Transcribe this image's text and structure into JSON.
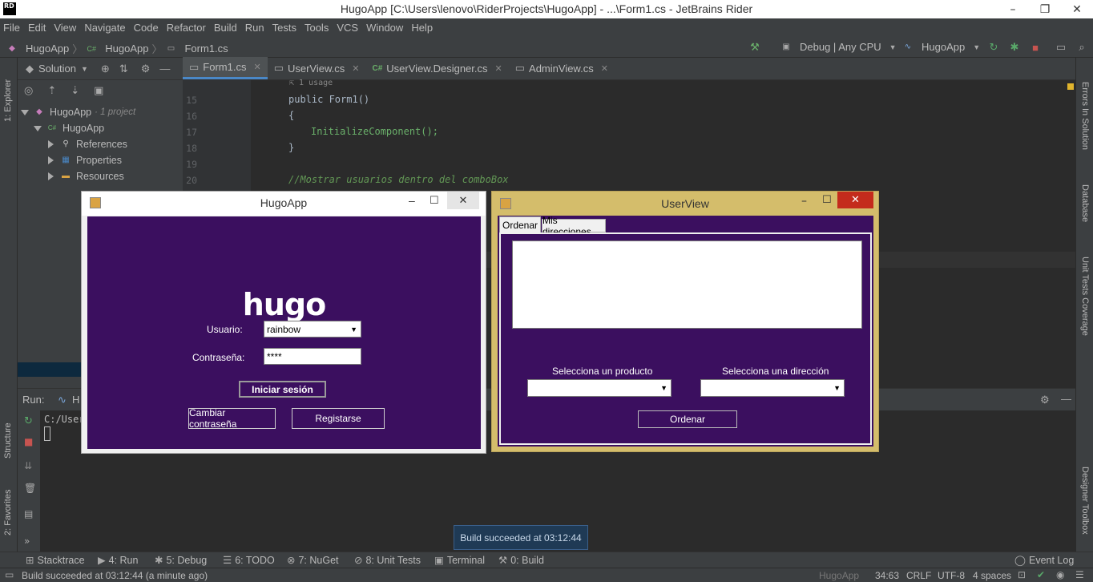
{
  "window": {
    "title": "HugoApp [C:\\Users\\lenovo\\RiderProjects\\HugoApp] - ...\\Form1.cs - JetBrains Rider",
    "logo": "RD"
  },
  "menu": [
    "File",
    "Edit",
    "View",
    "Navigate",
    "Code",
    "Refactor",
    "Build",
    "Run",
    "Tests",
    "Tools",
    "VCS",
    "Window",
    "Help"
  ],
  "breadcrumb": [
    "HugoApp",
    "HugoApp",
    "Form1.cs"
  ],
  "toolbar": {
    "config": "Debug | Any CPU",
    "run_target": "HugoApp"
  },
  "left_strip": {
    "explorer": "1: Explorer",
    "structure": "Structure",
    "favorites": "2: Favorites"
  },
  "right_strip": {
    "errors": "Errors In Solution",
    "database": "Database",
    "coverage": "Unit Tests Coverage",
    "toolbox": "Designer Toolbox"
  },
  "solution": {
    "view": "Solution",
    "items": [
      {
        "label": "HugoApp",
        "note": "· 1 project"
      },
      {
        "label": "HugoApp"
      },
      {
        "label": "References"
      },
      {
        "label": "Properties"
      },
      {
        "label": "Resources"
      }
    ]
  },
  "tabs": [
    {
      "label": "Form1.cs",
      "lang": "cs"
    },
    {
      "label": "UserView.cs",
      "lang": "cs"
    },
    {
      "label": "UserView.Designer.cs",
      "lang": "C#"
    },
    {
      "label": "AdminView.cs",
      "lang": "cs"
    }
  ],
  "editor": {
    "usage": "1 usage",
    "lines": [
      {
        "n": "15",
        "text": "public Form1()"
      },
      {
        "n": "16",
        "text": "{"
      },
      {
        "n": "17",
        "text": "InitializeComponent();"
      },
      {
        "n": "18",
        "text": "}"
      },
      {
        "n": "19",
        "text": ""
      },
      {
        "n": "20",
        "text": "//Mostrar usuarios dentro del comboBox"
      }
    ]
  },
  "run": {
    "label": "Run:",
    "tab": "H",
    "console": "C:/User"
  },
  "bottom_tools": [
    "Stacktrace",
    "4: Run",
    "5: Debug",
    "6: TODO",
    "7: NuGet",
    "8: Unit Tests",
    "Terminal",
    "0: Build"
  ],
  "event_log": "Event Log",
  "status": {
    "message": "Build succeeded at 03:12:44 (a minute ago)",
    "project": "HugoApp",
    "position": "34:63",
    "line_ending": "CRLF",
    "encoding": "UTF-8",
    "indent": "4 spaces"
  },
  "toast": "Build succeeded at 03:12:44",
  "login_window": {
    "title": "HugoApp",
    "logo": "hugo",
    "user_label": "Usuario:",
    "user_value": "rainbow",
    "pass_label": "Contraseña:",
    "pass_value": "****",
    "login_btn": "Iniciar sesión",
    "change_btn": "Cambiar contraseña",
    "register_btn": "Registarse"
  },
  "user_window": {
    "title": "UserView",
    "tabs": [
      "Ordenar",
      "Mis direcciones"
    ],
    "product_label": "Selecciona un producto",
    "address_label": "Selecciona una dirección",
    "order_btn": "Ordenar"
  },
  "colors": {
    "form_bg": "#3b0f5f",
    "userview_border": "#d4bd6b",
    "accent": "#4a88c7"
  }
}
